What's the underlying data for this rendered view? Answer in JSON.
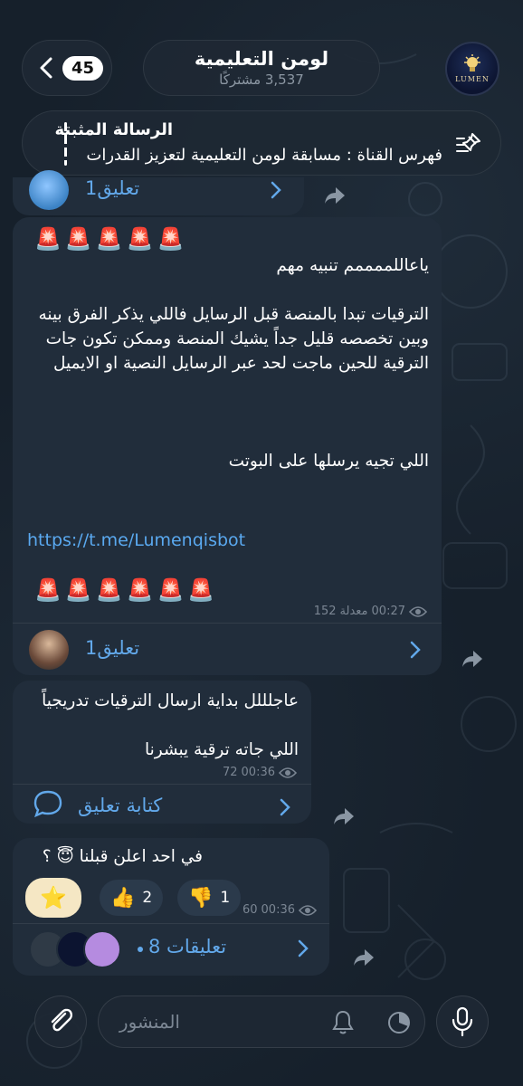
{
  "header": {
    "unread_count": "45",
    "channel_title": "لومن التعليمية",
    "subscribers": "3,537 مشتركًا",
    "logo_text": "LUMEN"
  },
  "pinned": {
    "title": "الرسالة المثبتة",
    "text": "فهرس القناة : مسابقة لومن التعليمية لتعزيز القدرات"
  },
  "messages": {
    "top_comment": "1تعليق",
    "main": {
      "sirens_top": "🚨🚨🚨🚨🚨",
      "text": "ياعاللممممم تنبيه مهم\n\nالترقيات تبدا بالمنصة قبل الرسايل فاللي يذكر الفرق بينه وبين تخصصه قليل جداً يشيك المنصة وممكن تكون جات الترقية للحين ماجت لحد عبر الرسايل النصية او الايميل\n\n\n\nاللي تجيه يرسلها على البوتت",
      "link": "https://t.me/Lumenqisbot",
      "sirens_bottom": "🚨🚨🚨🚨🚨🚨",
      "views": "152",
      "edited": "معدلة",
      "time": "00:27",
      "comment_label": "1تعليق"
    },
    "second": {
      "line1": "عاجلللل بداية ارسال الترقيات تدريجياً",
      "line2": "اللي جاته ترقية يبشرنا",
      "views": "72",
      "time": "00:36",
      "comment_label": "كتابة تعليق"
    },
    "third": {
      "text": "في احد اعلن قبلنا 😇 ؟",
      "reaction_star": "⭐",
      "reaction_up_emoji": "👍",
      "reaction_up_count": "2",
      "reaction_down_emoji": "👎",
      "reaction_down_count": "1",
      "views": "60",
      "time": "00:36",
      "comments_label": "8 تعليقات"
    }
  },
  "composer": {
    "placeholder": "المنشور"
  },
  "colors": {
    "accent": "#62a8ea",
    "bubble": "#212d3b",
    "background": "#16202b"
  }
}
